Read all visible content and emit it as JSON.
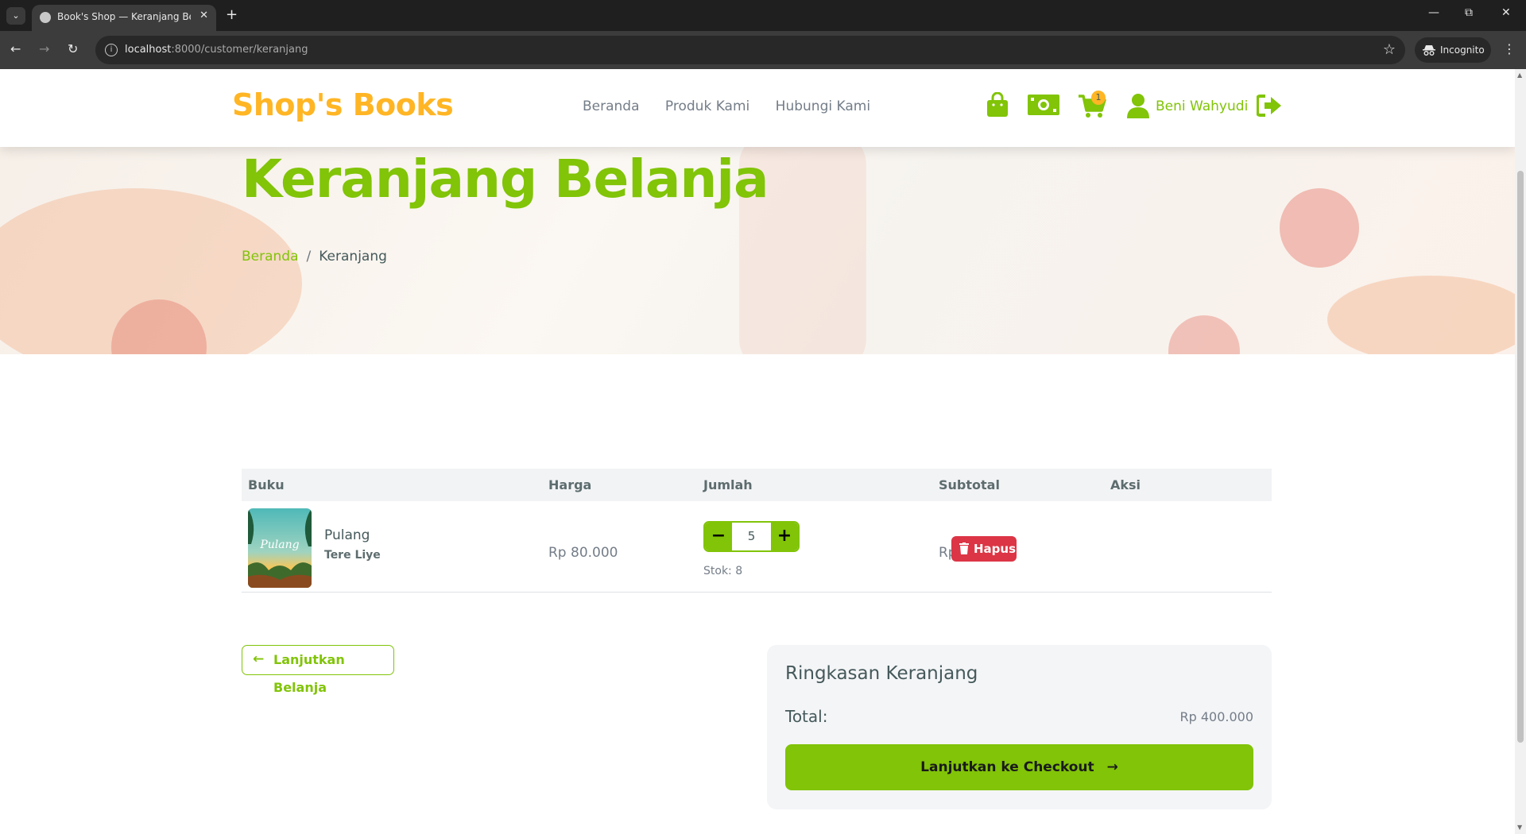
{
  "browser": {
    "tab_title": "Book's Shop — Keranjang Belanja",
    "url_host": "localhost",
    "url_rest": ":8000/customer/keranjang",
    "incognito_label": "Incognito"
  },
  "navbar": {
    "brand": "Shop's Books",
    "menu": [
      "Beranda",
      "Produk Kami",
      "Hubungi Kami"
    ],
    "cart_count": "1",
    "user_name": "Beni Wahyudi",
    "icons": [
      "shopping-bag-icon",
      "money-icon",
      "cart-icon",
      "user-icon",
      "logout-icon"
    ]
  },
  "hero": {
    "title": "Keranjang Belanja",
    "breadcrumb_home": "Beranda",
    "breadcrumb_sep": "/",
    "breadcrumb_current": "Keranjang"
  },
  "table": {
    "headers": [
      "Buku",
      "Harga",
      "Jumlah",
      "Subtotal",
      "Aksi"
    ],
    "rows": [
      {
        "title": "Pulang",
        "author": "Tere Liye",
        "cover_text": "Pulang",
        "price": "Rp 80.000",
        "quantity": "5",
        "stock": "Stok: 8",
        "subtotal": "Rp 400.000",
        "action": "Hapus"
      }
    ]
  },
  "continue_label": "Lanjutkan Belanja",
  "summary": {
    "title": "Ringkasan Keranjang",
    "total_label": "Total:",
    "total_value": "Rp 400.000",
    "checkout_label": "Lanjutkan ke Checkout"
  },
  "colors": {
    "primary": "#81c408",
    "accent": "#ffb524",
    "danger": "#dc3545",
    "text": "#45595b"
  }
}
